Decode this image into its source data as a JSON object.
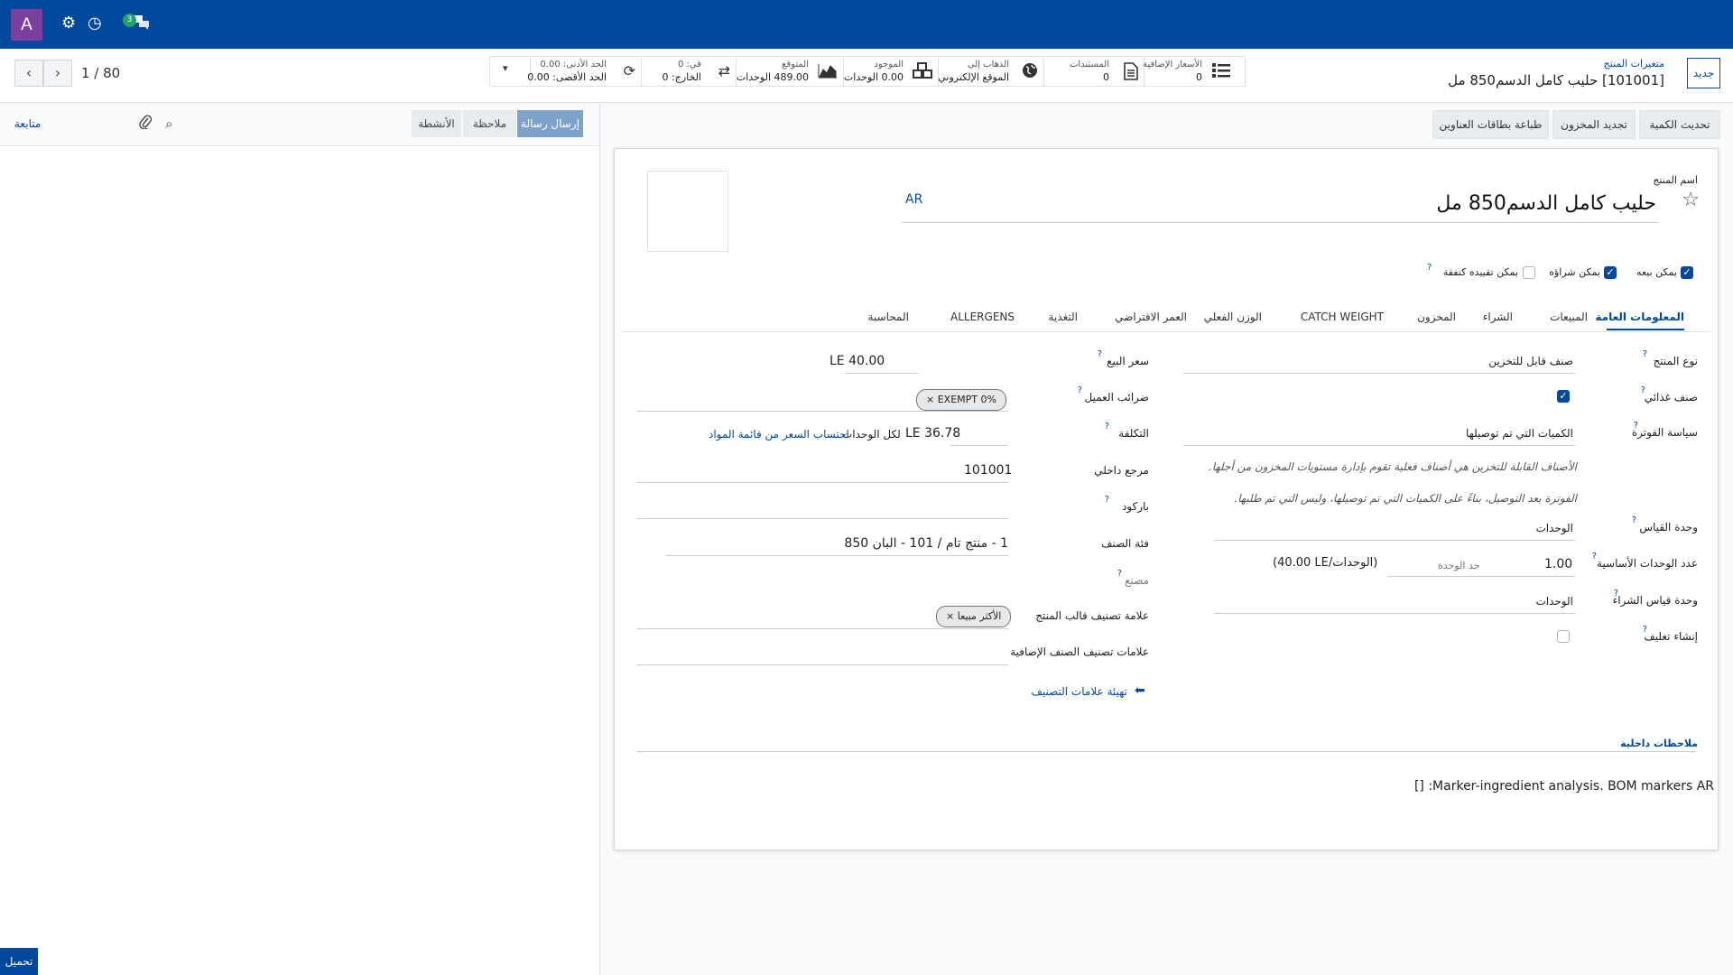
{
  "topbar": {
    "avatar_letter": "A",
    "chat_badge": "3",
    "colors": {
      "bar": "#02489c",
      "avatar": "#7b3fa0",
      "badge": "#21a367"
    }
  },
  "controls": {
    "pager": "1 / 80",
    "new_button": "جديد",
    "breadcrumb_parent": "متغيرات المنتج",
    "breadcrumb_current": "[101001] حليب كامل الدسم850 مل"
  },
  "smart_buttons": [
    {
      "icon": "list-icon",
      "line1": "الأسعار الإضافية",
      "line2": "0"
    },
    {
      "icon": "document-icon",
      "line1": "المستندات",
      "line2": "0"
    },
    {
      "icon": "globe-icon",
      "line1": "الذهاب إلى",
      "line2": "الموقع الإلكتروني"
    },
    {
      "icon": "cubes-icon",
      "line1": "الموجود",
      "line2": "0.00 الوحدات"
    },
    {
      "icon": "area-chart-icon",
      "line1": "المتوقع",
      "line2": "489.00 الوحدات"
    },
    {
      "icon": "exchange-icon",
      "line1": "في: 0",
      "line2": "الخارج: 0"
    },
    {
      "icon": "refresh-icon",
      "line1": "الحد الأدنى: 0.00",
      "line2": "الحد الأقصى: 0.00"
    }
  ],
  "header_actions": [
    "تحديث الكمية",
    "تجديد المخزون",
    "طباعة بطاقات العناوين"
  ],
  "chatter": {
    "send_message": "إرسال رسالة",
    "note": "ملاحظة",
    "activities": "الأنشطة",
    "follow": "متابعة",
    "upload": "تحميل"
  },
  "form": {
    "name_label": "اسم المنتج",
    "name_value": "حليب كامل الدسم850 مل",
    "lang_badge": "AR",
    "checks": [
      {
        "label": "يمكن بيعه",
        "checked": true
      },
      {
        "label": "يمكن شراؤه",
        "checked": true
      },
      {
        "label": "يمكن تقييده كنفقة",
        "checked": false
      }
    ],
    "tabs": [
      "المعلومات العامة",
      "المبيعات",
      "الشراء",
      "المخزون",
      "CATCH WEIGHT",
      "الوزن الفعلي",
      "العمر الافتراضي",
      "التغذية",
      "ALLERGENS",
      "المحاسبة"
    ],
    "right": {
      "product_type_label": "نوع المنتج",
      "product_type_value": "صنف قابل للتخزين",
      "food_label": "صنف غذائي",
      "invoice_policy_label": "سياسة الفوترة",
      "invoice_policy_value": "الكميات التي تم توصيلها",
      "help_1": "الأصناف القابلة للتخزين هي أصناف فعلية تقوم بإدارة مستويات المخزون من أجلها.",
      "help_2": "الفوترة بعد التوصيل، بناءً على الكميات التي تم توصيلها، وليس التي تم طلبها.",
      "uom_label": "وحدة القياس",
      "uom_value": "الوحدات",
      "base_units_label": "عدد الوحدات الأساسية",
      "base_units_value": "1.00",
      "unit_limit": "حد الوحدة",
      "unit_price": "(40.00 LE/الوحدات)",
      "purchase_uom_label": "وحدة قياس الشراء",
      "purchase_uom_value": "الوحدات",
      "packaging_label": "إنشاء تغليف"
    },
    "left": {
      "sale_price_label": "سعر البيع",
      "sale_price_value": "LE 40.00",
      "taxes_label": "ضرائب العميل",
      "tax_tag": "EXEMPT 0%",
      "cost_label": "التكلفة",
      "cost_value": "LE 36.78",
      "cost_per": "لكل الوحدات",
      "compute_bom": "احتساب السعر من قائمة المواد",
      "internal_ref_label": "مرجع داخلي",
      "internal_ref_value": "101001",
      "barcode_label": "باركود",
      "category_label": "فئة الصنف",
      "category_value": "1 - منتج تام / 101 - البان 850",
      "manufacturer_label": "مصنع",
      "template_tags_label": "علامة تصنيف قالب المنتج",
      "template_tag": "الأكثر مبيعا",
      "extra_tags_label": "علامات تصنيف الصنف الإضافية",
      "configure_tags": "تهيئة علامات التصنيف"
    },
    "internal_notes_label": "ملاحظات داخلية",
    "notes_text": "Marker-ingredient analysis. BOM markers AR: []"
  }
}
